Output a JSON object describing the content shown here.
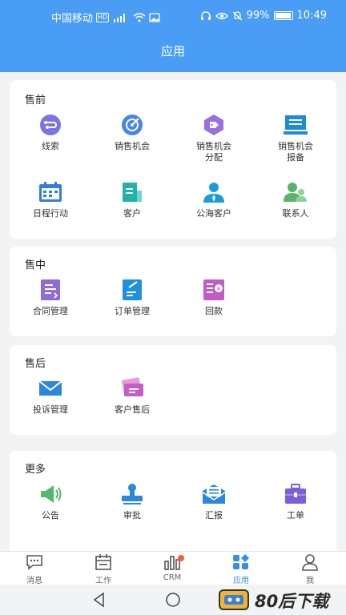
{
  "status_bar": {
    "carrier": "中国移动",
    "hd": "HD",
    "battery": "99%",
    "time": "10:49"
  },
  "header": {
    "title": "应用"
  },
  "sections": {
    "presale": {
      "title": "售前",
      "items": [
        {
          "label": "线索",
          "icon": "clue-icon"
        },
        {
          "label": "销售机会",
          "icon": "target-icon"
        },
        {
          "label": "销售机会分配",
          "line1": "销售机会",
          "line2": "分配",
          "icon": "tag-icon"
        },
        {
          "label": "销售机会报备",
          "line1": "销售机会",
          "line2": "报备",
          "icon": "monitor-icon"
        },
        {
          "label": "日程行动",
          "icon": "calendar-icon"
        },
        {
          "label": "客户",
          "icon": "customer-icon"
        },
        {
          "label": "公海客户",
          "icon": "person-icon"
        },
        {
          "label": "联系人",
          "icon": "contacts-icon"
        }
      ]
    },
    "insale": {
      "title": "售中",
      "items": [
        {
          "label": "合同管理",
          "icon": "contract-icon"
        },
        {
          "label": "订单管理",
          "icon": "order-icon"
        },
        {
          "label": "回款",
          "icon": "payment-icon"
        }
      ]
    },
    "aftersale": {
      "title": "售后",
      "items": [
        {
          "label": "投诉管理",
          "icon": "mail-icon"
        },
        {
          "label": "客户售后",
          "icon": "card-icon"
        }
      ]
    },
    "more": {
      "title": "更多",
      "items": [
        {
          "label": "公告",
          "icon": "megaphone-icon"
        },
        {
          "label": "审批",
          "icon": "stamp-icon"
        },
        {
          "label": "汇报",
          "icon": "report-icon"
        },
        {
          "label": "工单",
          "icon": "toolbox-icon"
        }
      ]
    }
  },
  "tabbar": {
    "tabs": [
      {
        "label": "消息",
        "icon": "message-icon"
      },
      {
        "label": "工作",
        "icon": "work-icon"
      },
      {
        "label": "CRM",
        "icon": "chart-icon"
      },
      {
        "label": "应用",
        "icon": "apps-icon",
        "active": true
      },
      {
        "label": "我",
        "icon": "user-icon"
      }
    ]
  },
  "watermark": {
    "text": "80后下载"
  },
  "colors": {
    "header": "#4a9df5",
    "accent": "#3a8ee6",
    "badge": "#ff5a3a"
  }
}
